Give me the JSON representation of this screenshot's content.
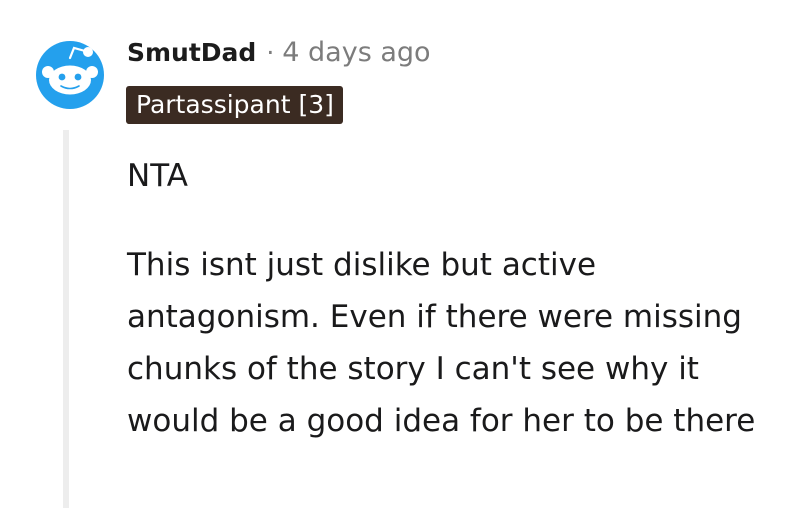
{
  "comment": {
    "author": "SmutDad",
    "separator": "·",
    "timestamp": "4 days ago",
    "flair": "Partassipant [3]",
    "paragraphs": [
      "NTA",
      "This isnt just dislike but active antagonism. Even if there were missing chunks of the story I can't see why it would be a good idea for her to be there"
    ]
  },
  "avatar": {
    "icon": "snoo-avatar-icon",
    "background_color": "#24a0ed"
  },
  "colors": {
    "flair_background": "#3b2b22",
    "thread_line": "#ededed",
    "muted_text": "#7c7c7c"
  }
}
